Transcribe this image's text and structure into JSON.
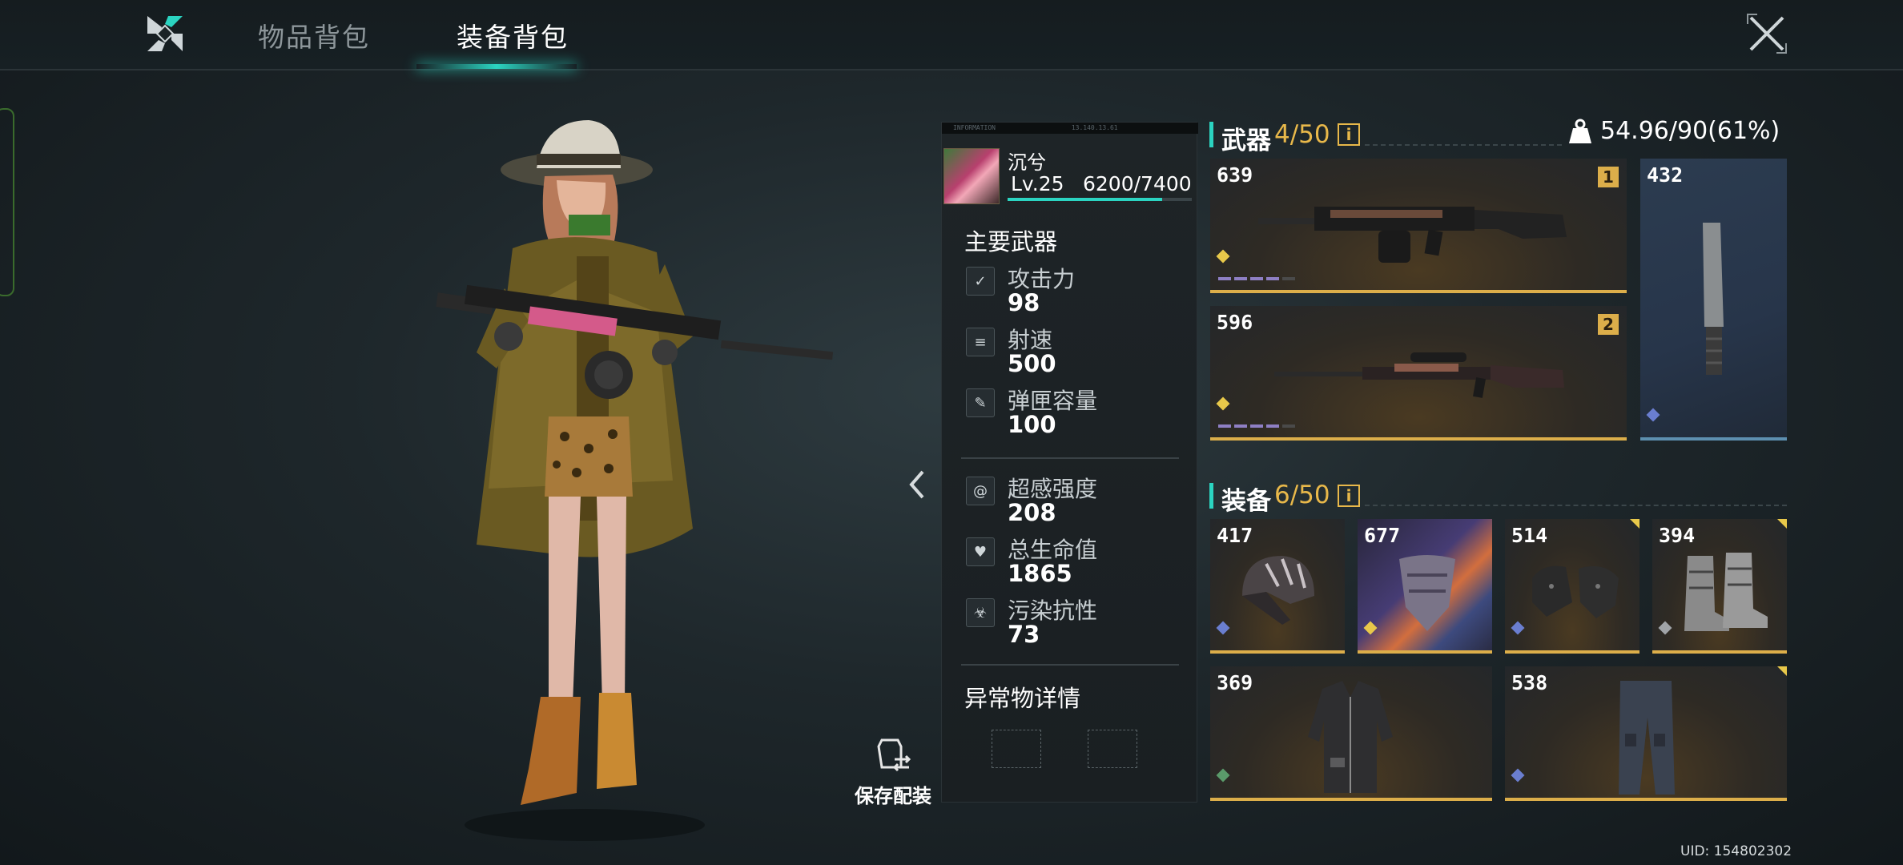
{
  "header": {
    "tabs": [
      {
        "label": "物品背包",
        "active": false
      },
      {
        "label": "装备背包",
        "active": true
      }
    ]
  },
  "colors": {
    "accent": "#2bd4c1",
    "gold": "#dcae4a",
    "blue_rarity": "#5d8fb0",
    "count": "#e8b84a"
  },
  "icons": {
    "logo": "game-logo-icon",
    "close": "close-icon",
    "collapse": "chevron-left-icon",
    "save": "save-loadout-icon",
    "weight": "weight-icon"
  },
  "player": {
    "name": "沉兮",
    "level": "Lv.25",
    "exp": "6200/7400",
    "exp_progress": 0.838
  },
  "stats_panel": {
    "strip_left": "INFORMATION",
    "strip_right": "13.140.13.61",
    "primary_weapon_title": "主要武器",
    "weapon_stats": [
      {
        "label": "攻击力",
        "value": "98",
        "icon": "attack-icon"
      },
      {
        "label": "射速",
        "value": "500",
        "icon": "fire-rate-icon"
      },
      {
        "label": "弹匣容量",
        "value": "100",
        "icon": "magazine-icon"
      }
    ],
    "body_stats": [
      {
        "label": "超感强度",
        "value": "208",
        "icon": "psi-spiral-icon"
      },
      {
        "label": "总生命值",
        "value": "1865",
        "icon": "heart-icon"
      },
      {
        "label": "污染抗性",
        "value": "73",
        "icon": "biohazard-icon"
      }
    ],
    "anomaly_title": "异常物详情"
  },
  "save_loadout": {
    "label": "保存配装"
  },
  "weapons_section": {
    "title": "武器",
    "count": "4/50",
    "info": "i",
    "weight": "54.96/90(61%)",
    "items": [
      {
        "id": "639",
        "slot": "1",
        "type": "assault-rifle",
        "rarity": "gold",
        "mod_dots": 4,
        "mod_total": 5
      },
      {
        "id": "596",
        "slot": "2",
        "type": "sniper-rifle",
        "rarity": "gold",
        "mod_dots": 4,
        "mod_total": 5
      },
      {
        "id": "432",
        "type": "melee-blade",
        "rarity": "blue"
      }
    ]
  },
  "gear_section": {
    "title": "装备",
    "count": "6/50",
    "info": "i",
    "items": [
      {
        "id": "417",
        "type": "helmet",
        "rarity": "blue"
      },
      {
        "id": "677",
        "type": "face-mask",
        "rarity": "purple"
      },
      {
        "id": "514",
        "type": "gloves",
        "rarity": "blue"
      },
      {
        "id": "394",
        "type": "boots",
        "rarity": "white"
      },
      {
        "id": "369",
        "type": "jacket",
        "rarity": "green"
      },
      {
        "id": "538",
        "type": "pants",
        "rarity": "blue"
      }
    ]
  },
  "uid": "UID: 154802302"
}
